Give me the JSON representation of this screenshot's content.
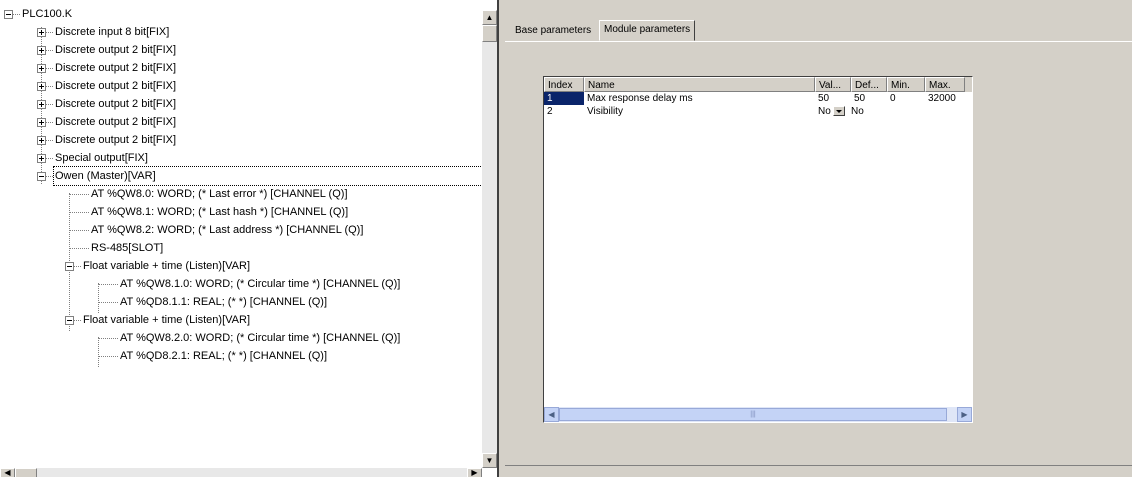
{
  "tree": {
    "items": [
      {
        "label": "PLC100.K",
        "expander": "minus"
      },
      {
        "label": "Discrete input 8 bit[FIX]",
        "expander": "plus"
      },
      {
        "label": "Discrete output 2 bit[FIX]",
        "expander": "plus"
      },
      {
        "label": "Discrete output 2 bit[FIX]",
        "expander": "plus"
      },
      {
        "label": "Discrete output 2 bit[FIX]",
        "expander": "plus"
      },
      {
        "label": "Discrete output 2 bit[FIX]",
        "expander": "plus"
      },
      {
        "label": "Discrete output 2 bit[FIX]",
        "expander": "plus"
      },
      {
        "label": "Discrete output 2 bit[FIX]",
        "expander": "plus"
      },
      {
        "label": "Special output[FIX]",
        "expander": "plus"
      },
      {
        "label": "Owen (Master)[VAR]",
        "expander": "minus",
        "selected": true
      },
      {
        "label": "AT %QW8.0: WORD; (* Last error *) [CHANNEL (Q)]"
      },
      {
        "label": "AT %QW8.1: WORD; (* Last hash *) [CHANNEL (Q)]"
      },
      {
        "label": "AT %QW8.2: WORD; (* Last address *) [CHANNEL (Q)]"
      },
      {
        "label": "RS-485[SLOT]"
      },
      {
        "label": "Float variable + time (Listen)[VAR]",
        "expander": "minus"
      },
      {
        "label": "AT %QW8.1.0: WORD; (* Circular time *) [CHANNEL (Q)]"
      },
      {
        "label": "AT %QD8.1.1: REAL; (*  *) [CHANNEL (Q)]"
      },
      {
        "label": "Float variable + time (Listen)[VAR]",
        "expander": "minus"
      },
      {
        "label": "AT %QW8.2.0: WORD; (* Circular time *) [CHANNEL (Q)]"
      },
      {
        "label": "AT %QD8.2.1: REAL; (*  *) [CHANNEL (Q)]"
      }
    ]
  },
  "tabs": [
    {
      "label": "Base parameters",
      "active": false
    },
    {
      "label": "Module parameters",
      "active": true
    }
  ],
  "grid": {
    "columns": [
      "Index",
      "Name",
      "Val...",
      "Def...",
      "Min.",
      "Max."
    ],
    "rows": [
      {
        "index": "1",
        "name": "Max response delay ms",
        "value": "50",
        "default": "50",
        "min": "0",
        "max": "32000"
      },
      {
        "index": "2",
        "name": "Visibility",
        "value": "No",
        "default": "No",
        "min": "",
        "max": ""
      }
    ]
  },
  "icons": {
    "scroll_up": "arrow-up-icon",
    "scroll_down": "arrow-down-icon",
    "scroll_left": "arrow-left-icon",
    "scroll_right": "arrow-right-icon",
    "combo": "chevron-down-icon"
  },
  "colors": {
    "selection": "#0a246a",
    "window_bg": "#d4d0c8"
  }
}
